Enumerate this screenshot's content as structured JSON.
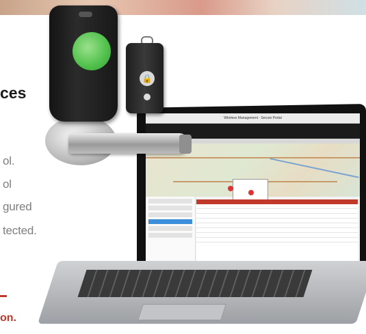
{
  "left_text": {
    "heading_fragment": "ces",
    "line1": "ol.",
    "line2": "ol",
    "line3": "gured",
    "line4": "tected.",
    "red_fragment": "on."
  },
  "app_window": {
    "title": "Wireless Management · Secure Portal"
  },
  "colors": {
    "accent_red": "#c0392b",
    "lock_green": "#4ec04a",
    "selection_blue": "#3d8fdc"
  }
}
